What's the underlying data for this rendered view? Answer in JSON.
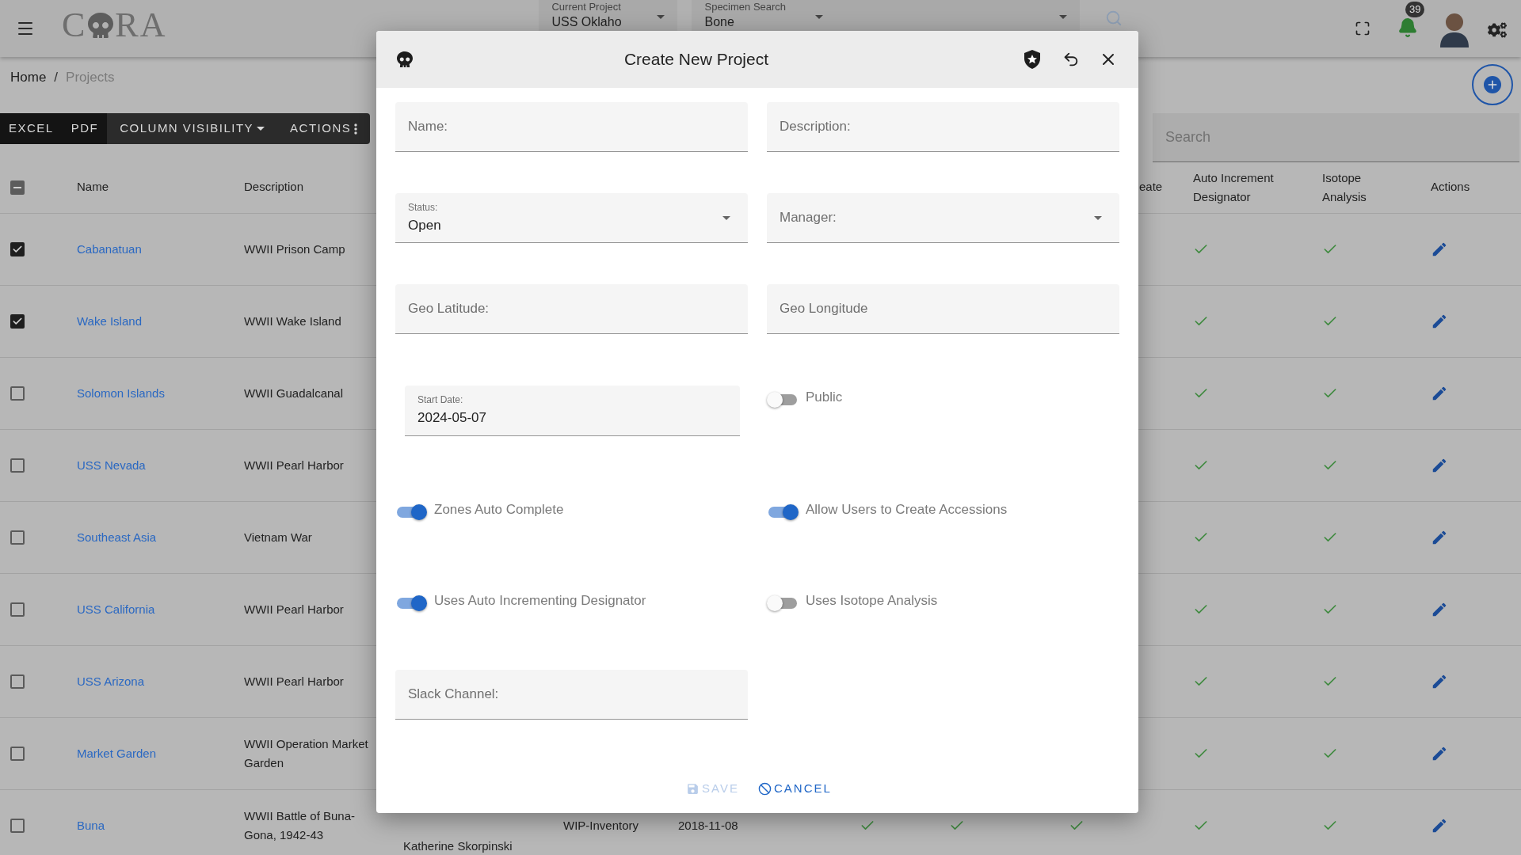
{
  "top_bar": {
    "logo": {
      "before": "C",
      "after": "RA"
    },
    "current_project": {
      "label": "Current Project",
      "value": "USS Oklaho"
    },
    "specimen_search": {
      "label": "Specimen Search",
      "value": "Bone"
    },
    "notification_count": "39"
  },
  "breadcrumb": {
    "separator": "/",
    "items": [
      {
        "label": "Home",
        "selected": false
      },
      {
        "label": "Projects",
        "selected": true
      }
    ]
  },
  "toolbar": [
    {
      "label": "EXCEL",
      "kind": "export"
    },
    {
      "label": "PDF",
      "kind": "export"
    },
    {
      "label": "COLUMN VISIBILITY",
      "kind": "dropdown"
    },
    {
      "label": "ACTIONS",
      "kind": "menu"
    }
  ],
  "search": {
    "placeholder": "Search"
  },
  "table": {
    "indeterminate": true,
    "columns": [
      {
        "label": "Name"
      },
      {
        "label": "Description"
      },
      {
        "label": "eate"
      },
      {
        "label": "Auto Increment Designator"
      },
      {
        "label": "Isotope Analysis"
      },
      {
        "label": "Actions"
      }
    ],
    "rows": [
      {
        "name": "Cabanatuan",
        "description": "WWII Prison Camp",
        "checked": true,
        "auto_increment": true,
        "isotope": true
      },
      {
        "name": "Wake Island",
        "description": "WWII Wake Island",
        "checked": true,
        "auto_increment": true,
        "isotope": true
      },
      {
        "name": "Solomon Islands",
        "description": "WWII Guadalcanal",
        "checked": false,
        "auto_increment": true,
        "isotope": true
      },
      {
        "name": "USS Nevada",
        "description": "WWII Pearl Harbor",
        "checked": false,
        "auto_increment": true,
        "isotope": true
      },
      {
        "name": "Southeast Asia",
        "description": "Vietnam War",
        "checked": false,
        "auto_increment": true,
        "isotope": true
      },
      {
        "name": "USS California",
        "description": "WWII Pearl Harbor",
        "checked": false,
        "auto_increment": true,
        "isotope": true
      },
      {
        "name": "USS Arizona",
        "description": "WWII Pearl Harbor",
        "checked": false,
        "auto_increment": true,
        "isotope": true
      },
      {
        "name": "Market Garden",
        "description": "WWII Operation Market Garden",
        "checked": false,
        "auto_increment": true,
        "isotope": true
      },
      {
        "name": "Buna",
        "description": "WWII Battle of Buna-Gona, 1942-43",
        "checked": false,
        "auto_increment": true,
        "isotope": true,
        "manager": "Katherine Skorpinski",
        "status": "WIP-Inventory",
        "start_date": "2018-11-08",
        "flags": [
          true,
          true,
          true
        ]
      }
    ]
  },
  "dialog": {
    "title": "Create New Project",
    "fields": [
      {
        "kind": "text",
        "placeholder": "Name:"
      },
      {
        "kind": "text",
        "placeholder": "Description:"
      },
      {
        "kind": "select",
        "label": "Status:",
        "value": "Open"
      },
      {
        "kind": "select",
        "label": "Manager:"
      },
      {
        "kind": "text",
        "placeholder": "Geo Latitude:"
      },
      {
        "kind": "text",
        "placeholder": "Geo Longitude"
      },
      {
        "kind": "date",
        "label": "Start Date:",
        "value": "2024-05-07"
      },
      {
        "kind": "toggle",
        "label": "Public",
        "on": false
      },
      {
        "kind": "toggle",
        "label": "Zones Auto Complete",
        "on": true
      },
      {
        "kind": "toggle",
        "label": "Allow Users to Create Accessions",
        "on": true
      },
      {
        "kind": "toggle",
        "label": "Uses Auto Incrementing Designator",
        "on": true
      },
      {
        "kind": "toggle",
        "label": "Uses Isotope Analysis",
        "on": false
      },
      {
        "kind": "text",
        "placeholder": "Slack Channel:"
      }
    ],
    "buttons": [
      {
        "label": "SAVE",
        "kind": "save",
        "disabled": true
      },
      {
        "label": "CANCEL",
        "kind": "cancel",
        "disabled": false
      }
    ]
  }
}
